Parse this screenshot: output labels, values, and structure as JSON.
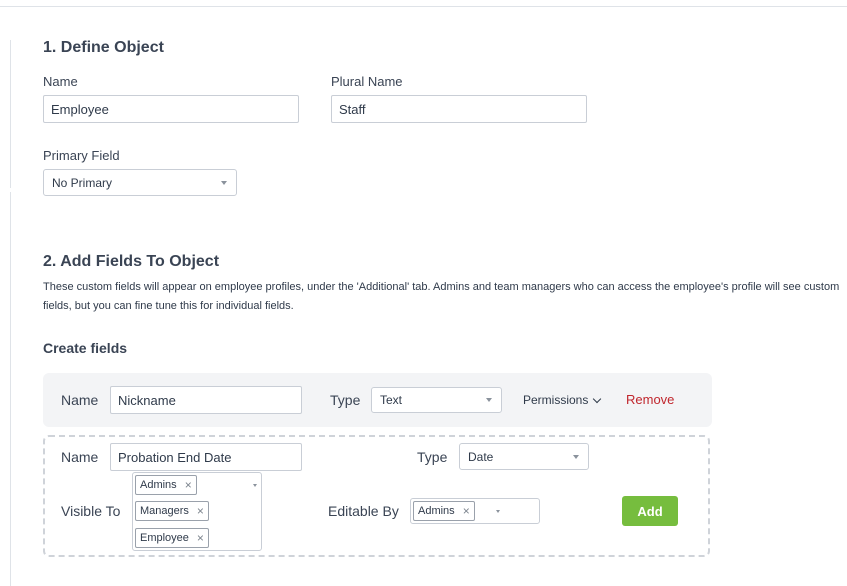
{
  "section1": {
    "title": "1. Define Object",
    "name_label": "Name",
    "name_value": "Employee",
    "plural_label": "Plural Name",
    "plural_value": "Staff",
    "primary_label": "Primary Field",
    "primary_value": "No Primary"
  },
  "section2": {
    "title": "2. Add Fields To Object",
    "description": "These custom fields will appear on employee profiles, under the 'Additional' tab. Admins and team managers who can access the employee's profile will see custom fields, but you can fine tune this for individual fields.",
    "create_title": "Create fields"
  },
  "field1": {
    "name_label": "Name",
    "name_value": "Nickname",
    "type_label": "Type",
    "type_value": "Text",
    "permissions_label": "Permissions",
    "remove_label": "Remove"
  },
  "field2": {
    "name_label": "Name",
    "name_value": "Probation End Date",
    "type_label": "Type",
    "type_value": "Date",
    "visible_label": "Visible To",
    "visible_tags": [
      "Admins",
      "Managers",
      "Employee"
    ],
    "editable_label": "Editable By",
    "editable_tags": [
      "Admins"
    ],
    "add_label": "Add"
  },
  "icons": {
    "remove_tag": "×"
  },
  "colors": {
    "accent_green": "#76bd3e",
    "danger_red": "#c0262d"
  }
}
